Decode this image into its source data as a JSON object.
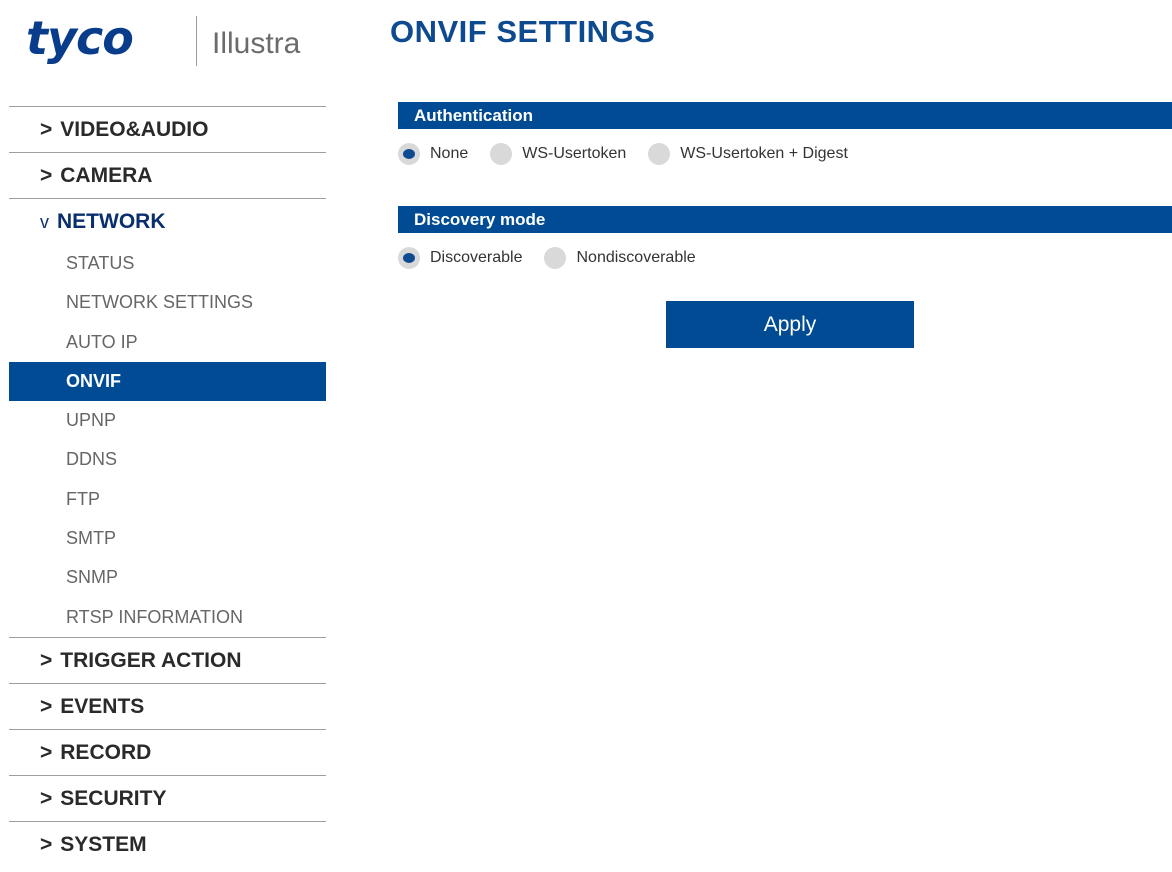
{
  "logo": {
    "brand": "tyco",
    "product": "Illustra"
  },
  "page_title": "ONVIF SETTINGS",
  "sidebar": {
    "top_before": [
      {
        "label": "VIDEO&AUDIO",
        "chevron": ">"
      },
      {
        "label": "CAMERA",
        "chevron": ">"
      }
    ],
    "open_section": {
      "label": "NETWORK",
      "chevron": "v"
    },
    "sub_items": [
      {
        "label": "STATUS"
      },
      {
        "label": "NETWORK SETTINGS"
      },
      {
        "label": "AUTO IP"
      },
      {
        "label": "ONVIF",
        "active": true
      },
      {
        "label": "UPNP"
      },
      {
        "label": "DDNS"
      },
      {
        "label": "FTP"
      },
      {
        "label": "SMTP"
      },
      {
        "label": "SNMP"
      },
      {
        "label": "RTSP INFORMATION"
      }
    ],
    "top_after": [
      {
        "label": "TRIGGER ACTION",
        "chevron": ">"
      },
      {
        "label": "EVENTS",
        "chevron": ">"
      },
      {
        "label": "RECORD",
        "chevron": ">"
      },
      {
        "label": "SECURITY",
        "chevron": ">"
      },
      {
        "label": "SYSTEM",
        "chevron": ">"
      }
    ]
  },
  "authentication": {
    "title": "Authentication",
    "options": [
      "None",
      "WS-Usertoken",
      "WS-Usertoken + Digest"
    ],
    "selected": "None"
  },
  "discovery": {
    "title": "Discovery mode",
    "options": [
      "Discoverable",
      "Nondiscoverable"
    ],
    "selected": "Discoverable"
  },
  "apply_label": "Apply",
  "colors": {
    "accent": "#004b93",
    "title": "#0d4a8f",
    "radio_bg": "#d9d9d9"
  }
}
